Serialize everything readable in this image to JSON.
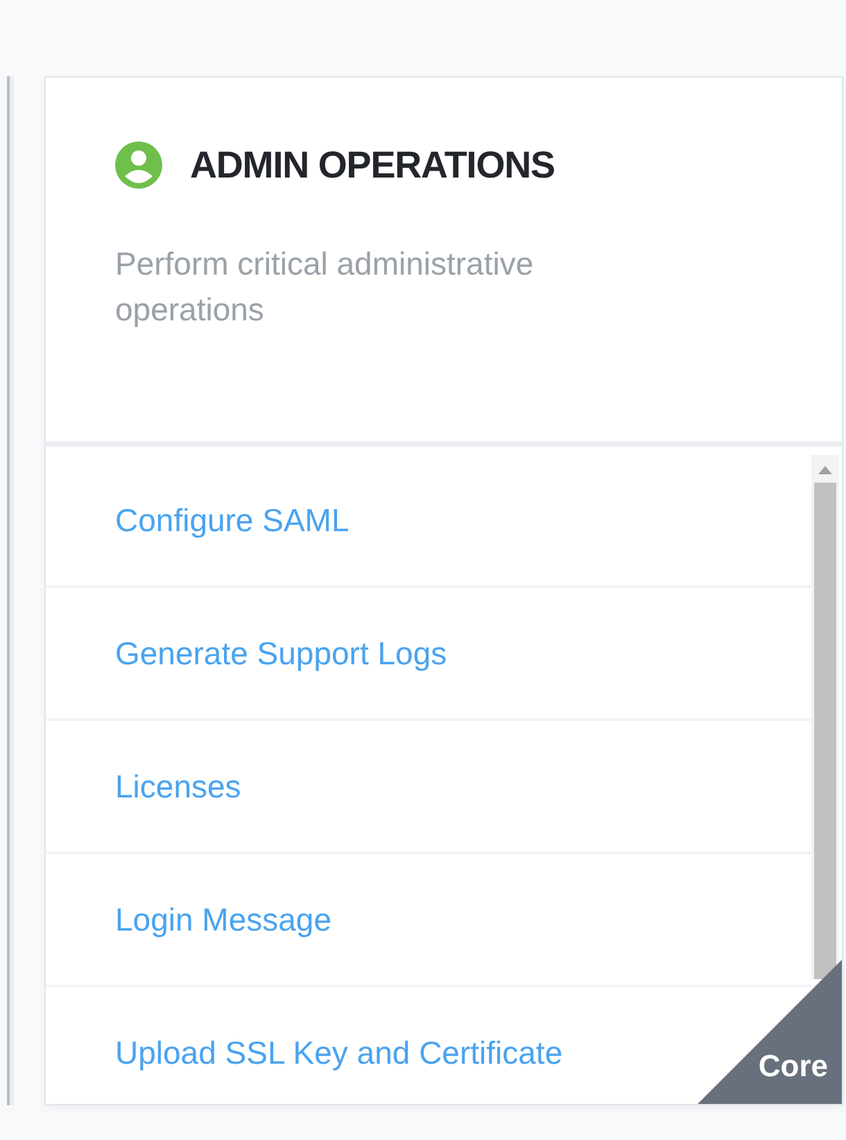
{
  "card": {
    "title": "ADMIN OPERATIONS",
    "description": "Perform critical administrative operations",
    "badge": "Core"
  },
  "items": [
    {
      "label": "Configure SAML"
    },
    {
      "label": "Generate Support Logs"
    },
    {
      "label": "Licenses"
    },
    {
      "label": "Login Message"
    },
    {
      "label": "Upload SSL Key and Certificate"
    }
  ]
}
